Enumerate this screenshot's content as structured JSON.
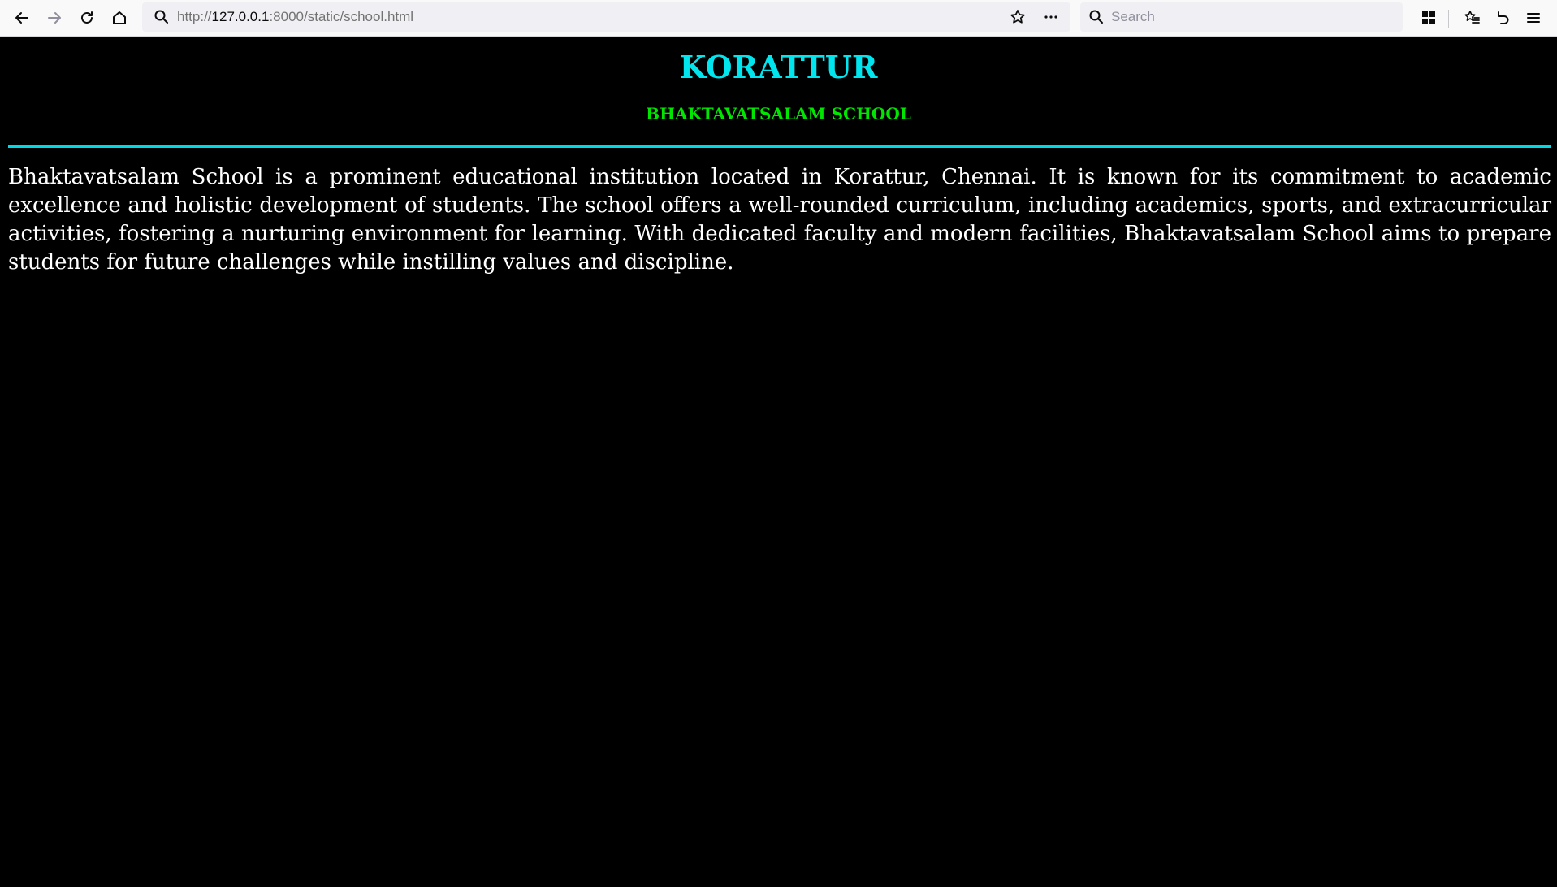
{
  "browser": {
    "url_prefix": "http://",
    "url_host": "127.0.0.1",
    "url_rest": ":8000/static/school.html",
    "search_placeholder": "Search",
    "icons": [
      "back-icon",
      "forward-icon",
      "reload-icon",
      "home-icon",
      "search-icon",
      "star-icon",
      "more-icon",
      "library-icon",
      "bookmarks-icon",
      "undo-icon",
      "menu-icon"
    ]
  },
  "page": {
    "heading": "KORATTUR",
    "subheading": "BHAKTAVATSALAM SCHOOL",
    "paragraph": "Bhaktavatsalam School is a prominent educational institution located in Korattur, Chennai. It is known for its commitment to academic excellence and holistic development of students. The school offers a well-rounded curriculum, including academics, sports, and extracurricular activities, fostering a nurturing environment for learning. With dedicated faculty and modern facilities, Bhaktavatsalam School aims to prepare students for future challenges while instilling values and discipline.",
    "colors": {
      "background": "#000000",
      "heading": "#00e5ee",
      "subheading": "#00e600",
      "divider": "#00d8e6",
      "text": "#ffffff"
    }
  }
}
